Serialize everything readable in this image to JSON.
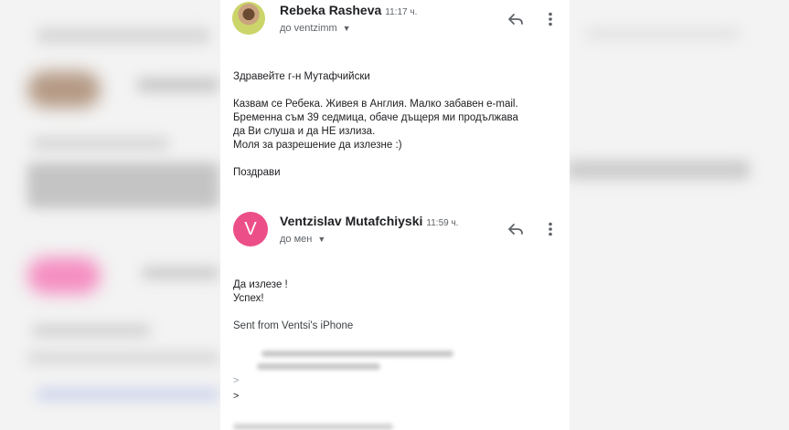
{
  "messages": [
    {
      "sender": "Rebeka Rasheva",
      "time": "11:17 ч.",
      "recipient": "до ventzimm",
      "body": [
        "Здравейте г-н Мутафчийски",
        "",
        "Казвам се Ребека. Живея в Англия. Малко забавен e-mail.",
        "Бременна съм 39 седмица, обаче дъщеря ми продължава",
        "да Ви слуша и да НЕ излиза.",
        "Моля за разрешение да излезне :)",
        "",
        "Поздрави"
      ]
    },
    {
      "sender": "Ventzislav Mutafchiyski",
      "avatar_letter": "V",
      "avatar_color": "#ec4f87",
      "time": "11:59 ч.",
      "recipient": "до мен",
      "body": [
        "Да излезе !",
        "Успех!",
        "",
        "Sent from Ventsi's iPhone"
      ],
      "quote_markers": [
        ">",
        ">"
      ]
    }
  ],
  "icons": {
    "reply": "reply-icon",
    "more": "more-vert-icon",
    "expand": "chevron-down-icon"
  }
}
